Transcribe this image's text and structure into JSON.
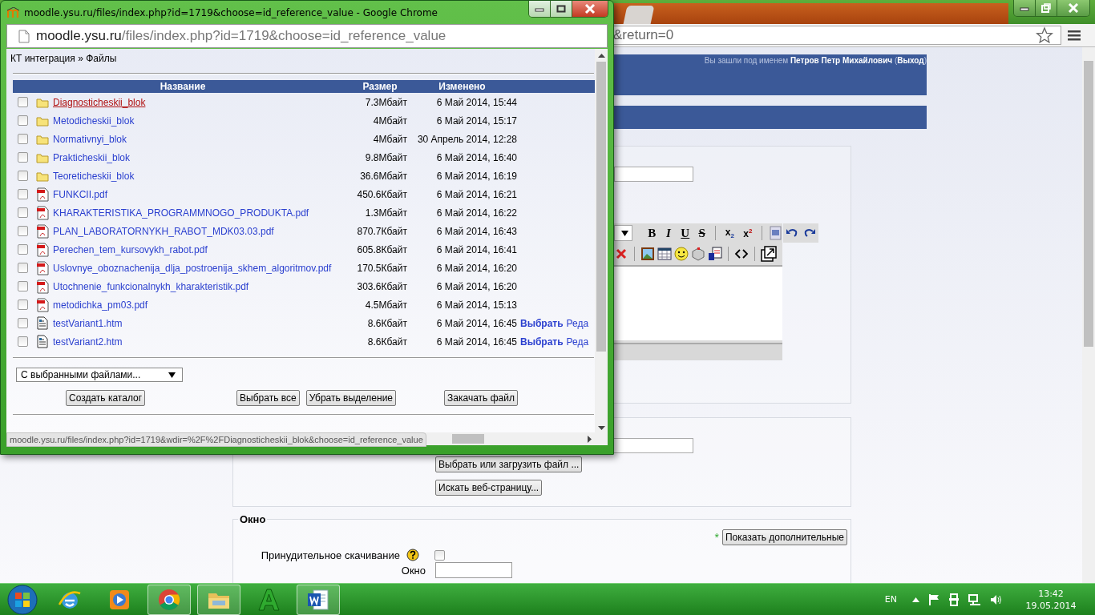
{
  "background_window": {
    "address_tail": "&return=0",
    "login_text": "Вы зашли под именем **Петров Петр Михайлович** (**Выход**)",
    "editor": {
      "format_buttons": [
        "B",
        "I",
        "U",
        "S"
      ],
      "script_buttons": [
        "x$_{2}$",
        "x$^{2}$"
      ]
    },
    "file_buttons": [
      "Выбрать или загрузить файл ...",
      "Искать веб-страницу..."
    ],
    "window_section": {
      "legend": "Окно",
      "required_mark": "*",
      "show_more_button": "Показать дополнительные",
      "force_download": {
        "label": "Принудительное скачивание",
        "checked": false
      },
      "window_label": "Окно"
    }
  },
  "popup": {
    "title": "moodle.ysu.ru/files/index.php?id=1719&choose=id_reference_value - Google Chrome",
    "address": {
      "host": "moodle.ysu.ru",
      "path": "/files/index.php?id=1719&choose=id_reference_value"
    },
    "breadcrumb": "КТ интеграция » Файлы",
    "columns": [
      "Название",
      "Размер",
      "Изменено"
    ],
    "rows": [
      {
        "kind": "folder",
        "name": "Diagnosticheskii_blok",
        "size": "7.3Мбайт",
        "modified": "6 Май 2014, 15:44",
        "checked": false,
        "hovered": true
      },
      {
        "kind": "folder",
        "name": "Metodicheskii_blok",
        "size": "4Мбайт",
        "modified": "6 Май 2014, 15:17",
        "checked": false,
        "hovered": false
      },
      {
        "kind": "folder",
        "name": "Normativnyi_blok",
        "size": "4Мбайт",
        "modified": "30 Апрель 2014, 12:28",
        "checked": false,
        "hovered": false
      },
      {
        "kind": "folder",
        "name": "Prakticheskii_blok",
        "size": "9.8Мбайт",
        "modified": "6 Май 2014, 16:40",
        "checked": false,
        "hovered": false
      },
      {
        "kind": "folder",
        "name": "Teoreticheskii_blok",
        "size": "36.6Мбайт",
        "modified": "6 Май 2014, 16:19",
        "checked": false,
        "hovered": false
      },
      {
        "kind": "pdf",
        "name": "FUNKCII.pdf",
        "size": "450.6Кбайт",
        "modified": "6 Май 2014, 16:21",
        "checked": false,
        "hovered": false
      },
      {
        "kind": "pdf",
        "name": "KHARAKTERISTIKA_PROGRAMMNOGO_PRODUKTA.pdf",
        "size": "1.3Мбайт",
        "modified": "6 Май 2014, 16:22",
        "checked": false,
        "hovered": false
      },
      {
        "kind": "pdf",
        "name": "PLAN_LABORATORNYKH_RABOT_MDK03.03.pdf",
        "size": "870.7Кбайт",
        "modified": "6 Май 2014, 16:43",
        "checked": false,
        "hovered": false
      },
      {
        "kind": "pdf",
        "name": "Perechen_tem_kursovykh_rabot.pdf",
        "size": "605.8Кбайт",
        "modified": "6 Май 2014, 16:41",
        "checked": false,
        "hovered": false
      },
      {
        "kind": "pdf",
        "name": "Uslovnye_oboznachenija_dlja_postroenija_skhem_algoritmov.pdf",
        "size": "170.5Кбайт",
        "modified": "6 Май 2014, 16:20",
        "checked": false,
        "hovered": false
      },
      {
        "kind": "pdf",
        "name": "Utochnenie_funkcionalnykh_kharakteristik.pdf",
        "size": "303.6Кбайт",
        "modified": "6 Май 2014, 16:20",
        "checked": false,
        "hovered": false
      },
      {
        "kind": "pdf",
        "name": "metodichka_pm03.pdf",
        "size": "4.5Мбайт",
        "modified": "6 Май 2014, 15:13",
        "checked": false,
        "hovered": false
      },
      {
        "kind": "htm",
        "name": "testVariant1.htm",
        "size": "8.6Кбайт",
        "modified": "6 Май 2014, 16:45",
        "checked": false,
        "hovered": false,
        "actions": [
          "Выбрать",
          "Реда"
        ]
      },
      {
        "kind": "htm",
        "name": "testVariant2.htm",
        "size": "8.6Кбайт",
        "modified": "6 Май 2014, 16:45",
        "checked": false,
        "hovered": false,
        "actions": [
          "Выбрать",
          "Реда"
        ]
      }
    ],
    "bulk_select": "С выбранными файлами...",
    "buttons": [
      "Создать каталог",
      "Выбрать все",
      "Убрать выделение",
      "Закачать файл"
    ],
    "status_url": "moodle.ysu.ru/files/index.php?id=1719&wdir=%2F%2FDiagnosticheskii_blok&choose=id_reference_value"
  },
  "taskbar": {
    "apps": [
      {
        "kind": "ie",
        "running": false
      },
      {
        "kind": "media",
        "running": false
      },
      {
        "kind": "chrome",
        "running": true
      },
      {
        "kind": "explorer",
        "running": true
      },
      {
        "kind": "a",
        "running": false
      },
      {
        "kind": "word",
        "running": true
      }
    ],
    "language": "EN",
    "time": "13:42",
    "date": "19.05.2014"
  }
}
